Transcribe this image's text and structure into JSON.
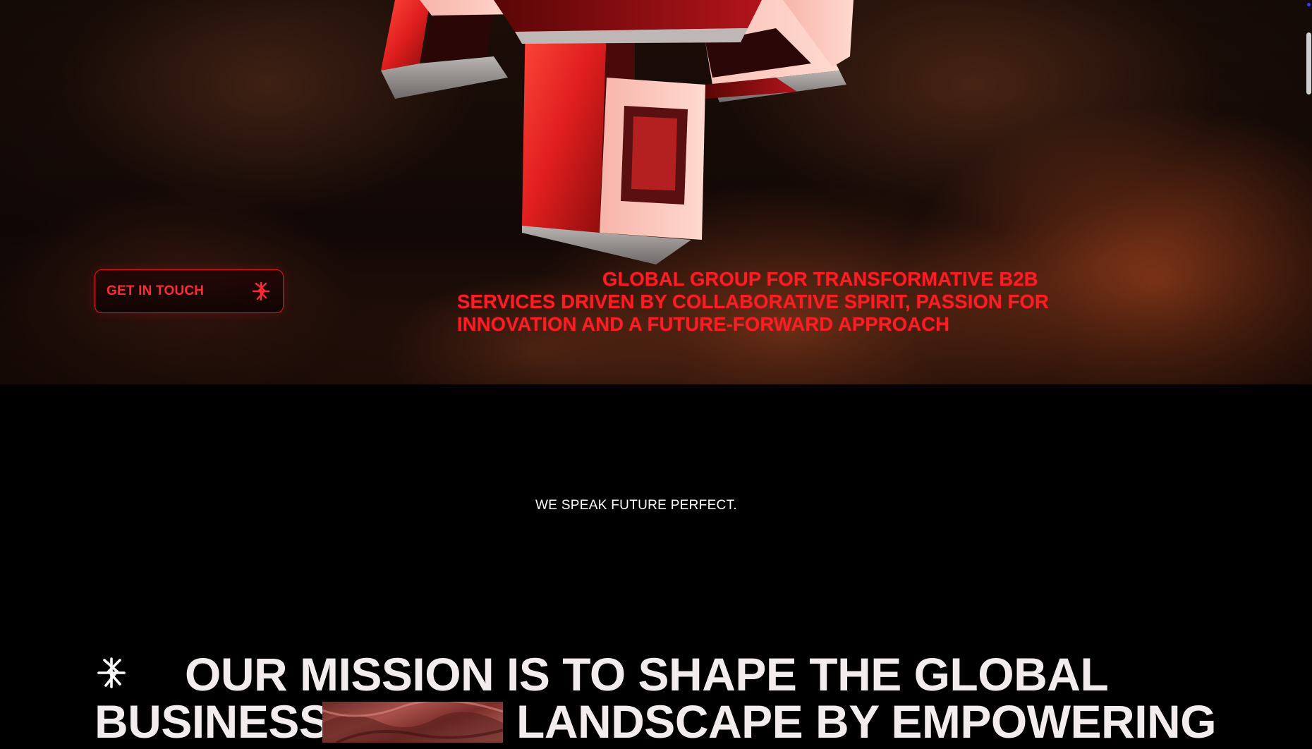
{
  "hero": {
    "cta_label": "GET IN TOUCH",
    "tagline_lines": [
      "GLOBAL GROUP FOR TRANSFORMATIVE B2B",
      "SERVICES DRIVEN BY COLLABORATIVE SPIRIT, PASSION FOR",
      "INNOVATION AND A FUTURE-FORWARD APPROACH"
    ]
  },
  "slogan": "WE SPEAK FUTURE PERFECT.",
  "mission": {
    "line1": "OUR MISSION IS TO SHAPE THE GLOBAL",
    "line2_before_image": "BUSINESS",
    "line2_after_image": "LANDSCAPE BY EMPOWERING"
  },
  "icons": {
    "cta": "brand-mark-icon",
    "mission": "brand-mark-icon",
    "hero_art": "3d-logo-sculpture"
  },
  "colors": {
    "accent": "#ff1c24",
    "background": "#000000",
    "heading": "#f3ecec"
  }
}
